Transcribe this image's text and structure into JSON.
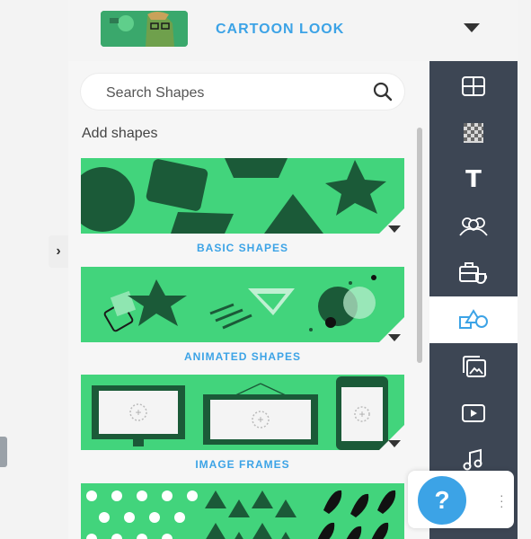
{
  "header": {
    "title": "CARTOON LOOK"
  },
  "search": {
    "placeholder": "Search Shapes"
  },
  "panel": {
    "section_label": "Add shapes",
    "cards": [
      {
        "label": "BASIC SHAPES"
      },
      {
        "label": "ANIMATED SHAPES"
      },
      {
        "label": "IMAGE FRAMES"
      }
    ]
  },
  "sidebar": {
    "items": [
      {
        "icon": "layout-icon"
      },
      {
        "icon": "background-icon"
      },
      {
        "icon": "text-icon",
        "glyph": "T"
      },
      {
        "icon": "characters-icon"
      },
      {
        "icon": "props-icon"
      },
      {
        "icon": "shapes-icon",
        "active": true
      },
      {
        "icon": "images-icon"
      },
      {
        "icon": "video-icon"
      },
      {
        "icon": "music-icon"
      }
    ]
  },
  "help": {
    "label": "?"
  },
  "colors": {
    "accent_blue": "#3ca3e6",
    "card_green": "#42d47c",
    "shape_dark_green": "#1b5a38",
    "sidebar_bg": "#3d4654"
  }
}
